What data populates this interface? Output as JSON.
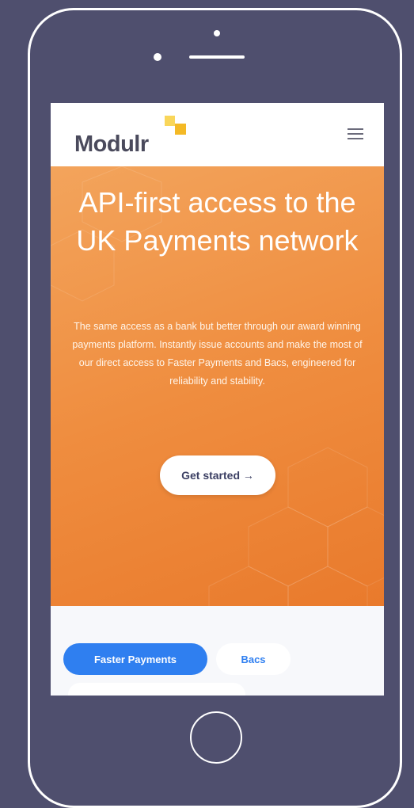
{
  "brand": {
    "name": "Modulr"
  },
  "hero": {
    "title": "API-first access to the UK Payments network",
    "body": "The same access as a bank but better through our award winning payments platform. Instantly issue accounts and make the most of our direct access to Faster Payments and Bacs, engineered for reliability and stability.",
    "cta_label": "Get started →"
  },
  "tabs": [
    {
      "label": "Faster Payments",
      "active": true
    },
    {
      "label": "Bacs",
      "active": false
    }
  ],
  "colors": {
    "background": "#4f4f6e",
    "hero_orange": "#ef8d3f",
    "accent_blue": "#2f7ff0",
    "logo_yellow": "#f4b925"
  },
  "icons": [
    "menu-icon",
    "home-button"
  ]
}
